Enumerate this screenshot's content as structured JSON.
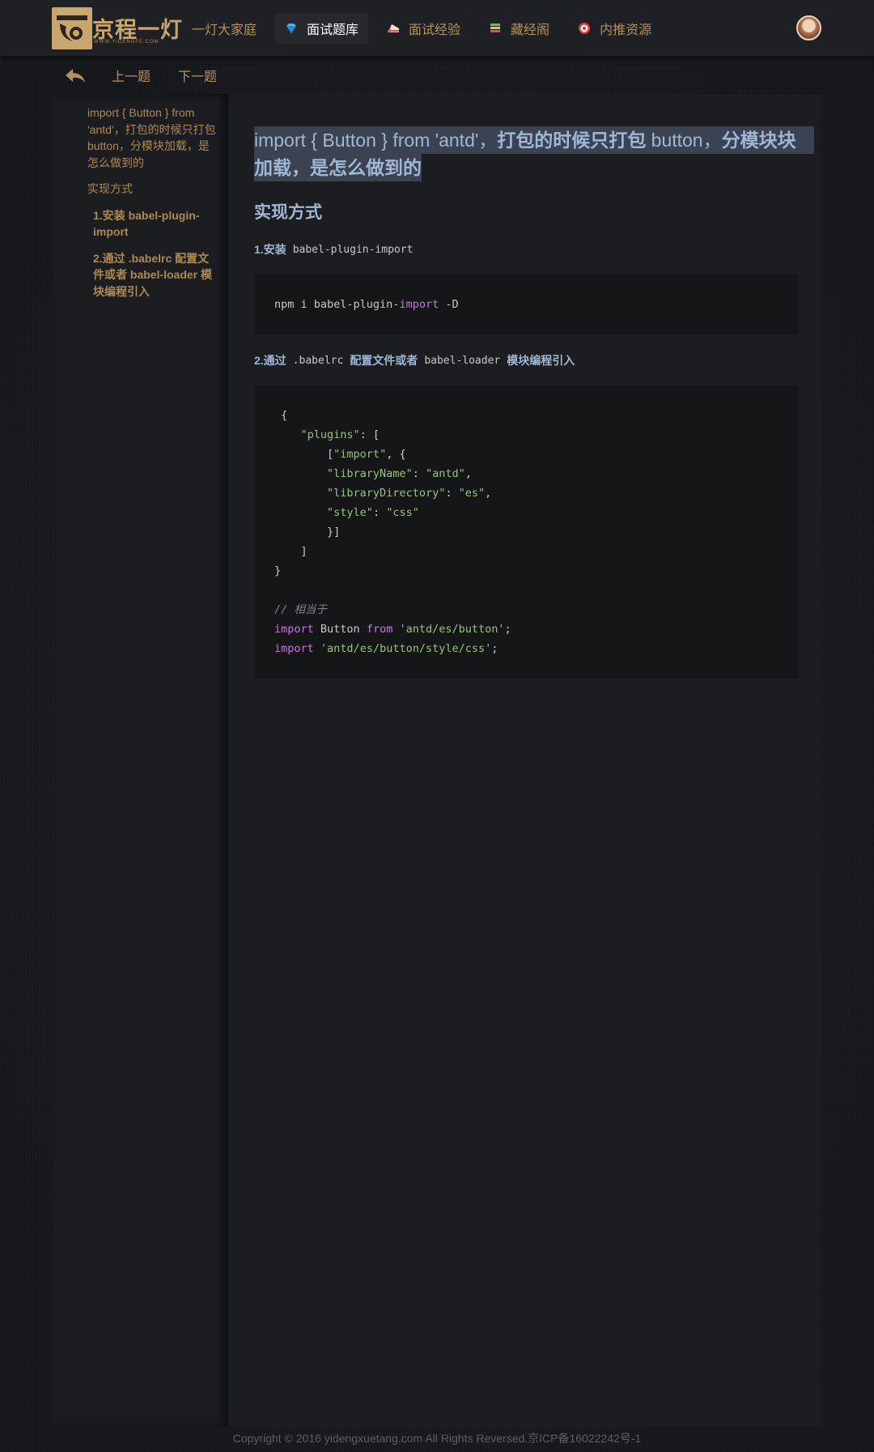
{
  "header": {
    "logo": {
      "brand": "京程一灯",
      "sub": "WWW.YIDENGFE.COM"
    },
    "nav": [
      {
        "label": "一灯大家庭",
        "icon": "",
        "active": false
      },
      {
        "label": "面试题库",
        "icon": "diamond-icon",
        "active": true
      },
      {
        "label": "面试经验",
        "icon": "cake-icon",
        "active": false
      },
      {
        "label": "藏经阁",
        "icon": "books-icon",
        "active": false
      },
      {
        "label": "内推资源",
        "icon": "target-icon",
        "active": false
      }
    ]
  },
  "subnav": {
    "prev": "上一题",
    "next": "下一题"
  },
  "toc": {
    "title": "import { Button } from 'antd'，打包的时候只打包 button，分模块加载，是怎么做到的",
    "section": "实现方式",
    "steps": [
      "1.安装 babel-plugin-import",
      "2.通过 .babelrc 配置文件或者 babel-loader 模块编程引入"
    ]
  },
  "article": {
    "title_plain_a": "import { Button } from 'antd'，",
    "title_bold_a": "打包的时候只打包",
    "title_plain_b": " button，",
    "title_bold_b": "分模块块",
    "title_line2": "加载，是怎么做到的",
    "section": "实现方式",
    "step1_label": "1.安装",
    "step1_code": "babel-plugin-import",
    "code1_a": "npm i babel-plugin-",
    "code1_kw": "import",
    "code1_b": " -D",
    "step2_label": "2.通过",
    "step2_code1": ".babelrc",
    "step2_mid": "配置文件或者",
    "step2_code2": "babel-loader",
    "step2_end": "模块编程引入",
    "code2": {
      "l1": " {",
      "l2_str": "\"plugins\"",
      "l2_rest": ": [",
      "l3_a": "[",
      "l3_str": "\"import\"",
      "l3_rest": ", {",
      "l4_k": "\"libraryName\"",
      "l4_v": "\"antd\"",
      "l5_k": "\"libraryDirectory\"",
      "l5_v": "\"es\"",
      "l6_k": "\"style\"",
      "l6_v": "\"css\"",
      "l7": "}]",
      "l8": "]",
      "l9": "}",
      "comment": "// 相当于",
      "imp1_kw": "import",
      "imp1_mid": " Button ",
      "imp1_from": "from",
      "imp1_str": "'antd/es/button'",
      "imp2_kw": "import",
      "imp2_str": "'antd/es/button/style/css'"
    }
  },
  "footer": "Copyright © 2016 yidengxuetang.com All Rights Reversed.京ICP备16022242号-1"
}
